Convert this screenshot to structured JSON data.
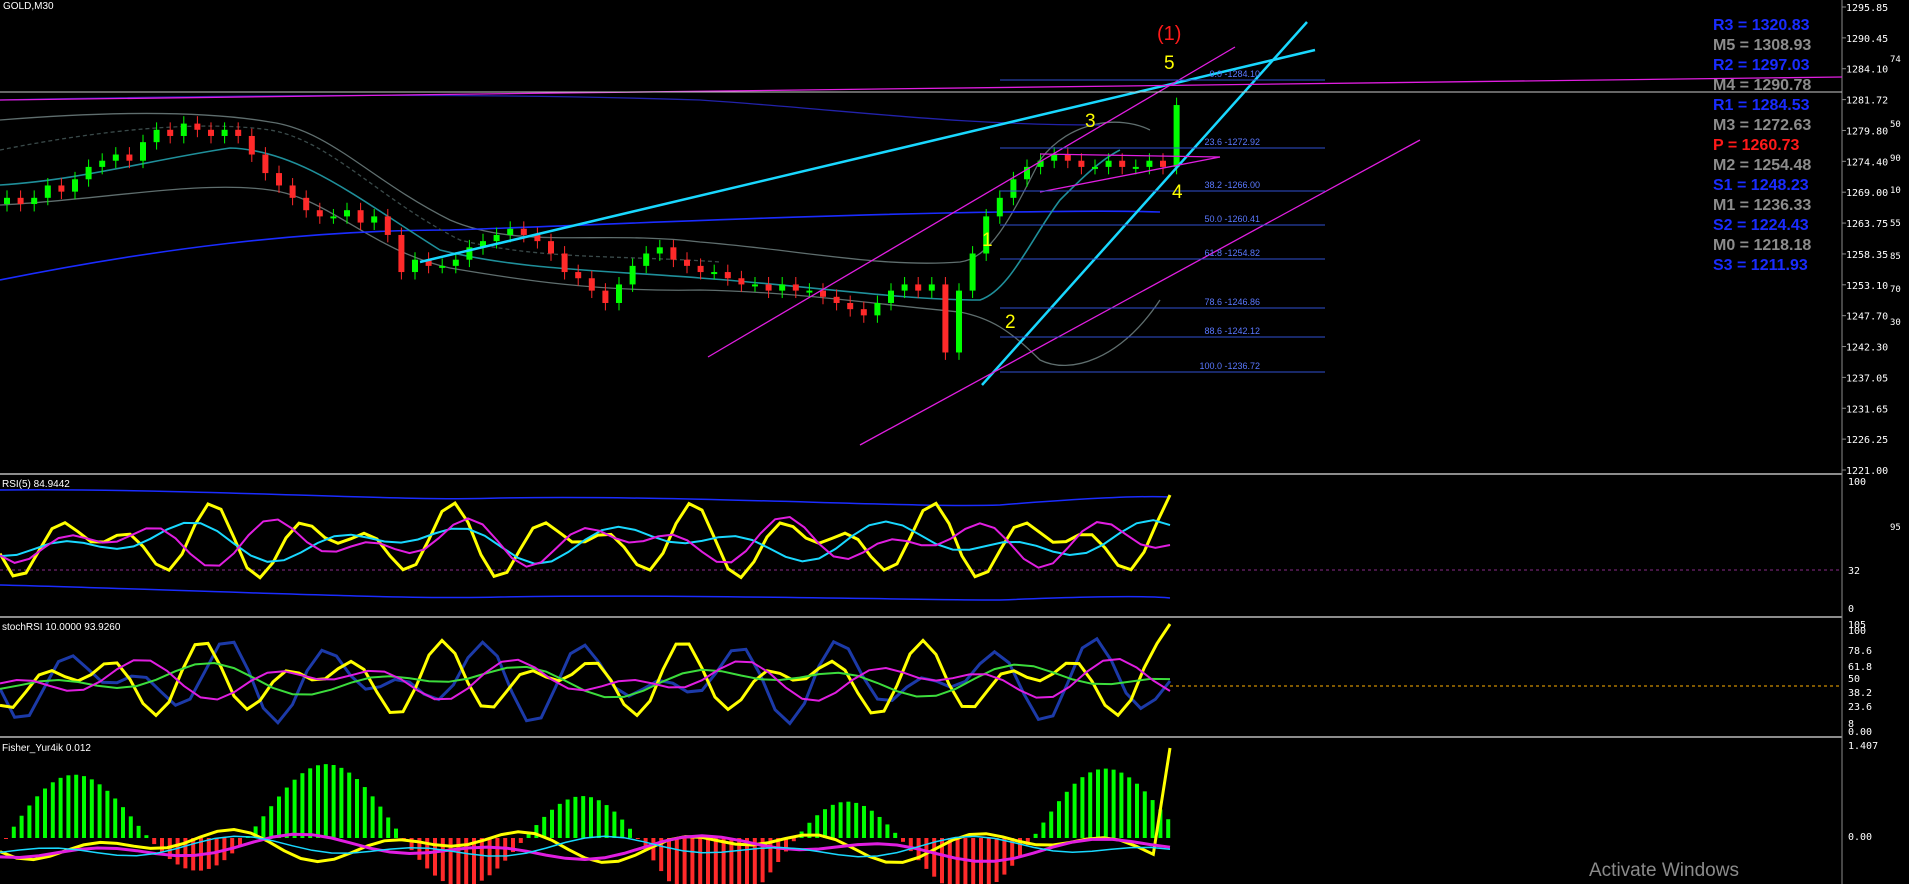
{
  "symbol": "GOLD,M30",
  "price_scale": [
    "1295.85",
    "1290.45",
    "1284.10",
    "1281.72",
    "1279.80",
    "1274.40",
    "1269.00",
    "1263.75",
    "1258.35",
    "1253.10",
    "1247.70",
    "1242.30",
    "1237.05",
    "1231.65",
    "1226.25",
    "1221.00"
  ],
  "wave_labels": [
    "(1)",
    "5",
    "3",
    "4",
    "1",
    "2"
  ],
  "fib_levels": [
    "0.0 -1284.10",
    "23.6 -1272.92",
    "38.2 -1266.00",
    "50.0 -1260.41",
    "61.8 -1254.82",
    "78.6 -1246.86",
    "88.6 -1242.12",
    "100.0 -1236.72"
  ],
  "pivots": [
    {
      "text": "R3 = 1320.83",
      "color": "#1a2cff"
    },
    {
      "text": "M5 = 1308.93",
      "color": "#8c8c8c"
    },
    {
      "text": "R2 = 1297.03",
      "color": "#1a2cff"
    },
    {
      "text": "M4 = 1290.78",
      "color": "#8c8c8c"
    },
    {
      "text": "R1 = 1284.53",
      "color": "#1a2cff"
    },
    {
      "text": "M3 = 1272.63",
      "color": "#8c8c8c"
    },
    {
      "text": "P   = 1260.73",
      "color": "#ff1a1a"
    },
    {
      "text": "M2 = 1254.48",
      "color": "#8c8c8c"
    },
    {
      "text": "S1 = 1248.23",
      "color": "#1a2cff"
    },
    {
      "text": "M1 = 1236.33",
      "color": "#8c8c8c"
    },
    {
      "text": "S2 = 1224.43",
      "color": "#1a2cff"
    },
    {
      "text": "M0 = 1218.18",
      "color": "#8c8c8c"
    },
    {
      "text": "S3 = 1211.93",
      "color": "#1a2cff"
    }
  ],
  "right_edge_labels": [
    "74",
    "50",
    "90",
    "10",
    "55",
    "85",
    "70",
    "30",
    "95"
  ],
  "rsi": {
    "title": "RSI(5) 84.9442",
    "scale": [
      "100",
      "32",
      "0"
    ],
    "level": 32
  },
  "stoch": {
    "title": "stochRSI 10.0000 93.9260",
    "scale": [
      "105",
      "100",
      "78.6",
      "61.8",
      "50",
      "38.2",
      "23.6",
      "8",
      "0.00"
    ]
  },
  "fisher": {
    "title": "Fisher_Yur4ik 0.012",
    "scale": [
      "1.407",
      "0.00"
    ]
  },
  "watermark": "Activate Windows",
  "colors": {
    "bull": "#00ff00",
    "bear": "#ff2a2a",
    "cyan": "#19d8ff",
    "magenta": "#e01ee0",
    "yellow": "#ffff00",
    "blue": "#1a2cff"
  },
  "chart_data": {
    "type": "candlestick",
    "title": "GOLD,M30",
    "ylim": [
      1221.0,
      1295.85
    ],
    "close": [
      1265,
      1264,
      1265,
      1267,
      1266,
      1268,
      1270,
      1271,
      1272,
      1271,
      1274,
      1276,
      1275,
      1277,
      1276,
      1275,
      1276,
      1275,
      1272,
      1269,
      1267,
      1265,
      1263,
      1262,
      1262,
      1263,
      1261,
      1262,
      1259,
      1253,
      1255,
      1254,
      1254,
      1255,
      1257,
      1258,
      1259,
      1260,
      1259,
      1258,
      1256,
      1253,
      1252,
      1250,
      1248,
      1251,
      1254,
      1256,
      1257,
      1255,
      1254,
      1253,
      1253,
      1252,
      1251,
      1251,
      1250,
      1251,
      1250,
      1250,
      1249,
      1248,
      1247,
      1246,
      1248,
      1250,
      1251,
      1250,
      1251,
      1240,
      1250,
      1256,
      1262,
      1265,
      1268,
      1270,
      1271,
      1272,
      1271,
      1270,
      1270,
      1271,
      1270,
      1270,
      1271,
      1270,
      1280
    ]
  }
}
